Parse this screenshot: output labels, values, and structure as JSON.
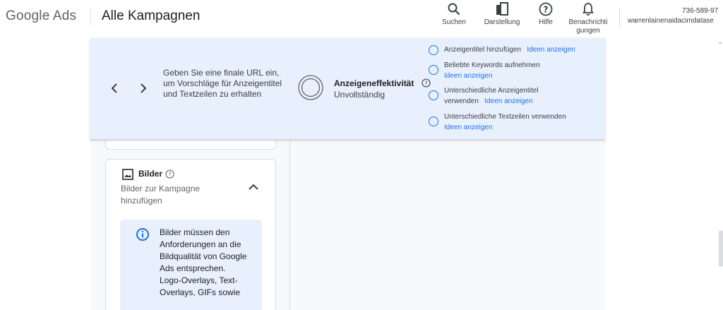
{
  "header": {
    "logo": "Google Ads",
    "title": "Alle Kampagnen",
    "tools": [
      {
        "label": "Suchen",
        "icon": "search-icon"
      },
      {
        "label": "Darstellung",
        "icon": "appearance-icon"
      },
      {
        "label": "Hilfe",
        "icon": "help-icon"
      },
      {
        "label_line1": "Benachrichti",
        "label_line2": "gungen",
        "icon": "bell-icon"
      }
    ],
    "account_id": "736-589-97",
    "account_email": "warrenlainenaidacimdatase"
  },
  "banner": {
    "message": "Geben Sie eine finale URL ein, um Vorschläge für Anzeigentitel und Textzeilen zu erhalten",
    "effectiveness_label": "Anzeigeneffektivität",
    "effectiveness_status": "Unvollständig",
    "suggestions": [
      {
        "text": "Anzeigentitel hinzufügen",
        "link": "Ideen anzeigen"
      },
      {
        "text": "Beliebte Keywords aufnehmen",
        "link": "Ideen anzeigen"
      },
      {
        "text_line1": "Unterschiedliche Anzeigentitel",
        "text_line2": "verwenden",
        "link": "Ideen anzeigen"
      },
      {
        "text": "Unterschiedliche Textzeilen verwenden",
        "link": "Ideen anzeigen"
      }
    ]
  },
  "images_card": {
    "title": "Bilder",
    "subtitle": "Bilder zur Kampagne hinzufügen",
    "info": "Bilder müssen den Anforderungen an die Bildqualität von Google Ads entsprechen. Logo-Overlays, Text-Overlays, GIFs sowie"
  },
  "colors": {
    "accent": "#1a73e8",
    "banner_bg": "#e8f0fe",
    "info_bg": "#e8f0fe"
  }
}
